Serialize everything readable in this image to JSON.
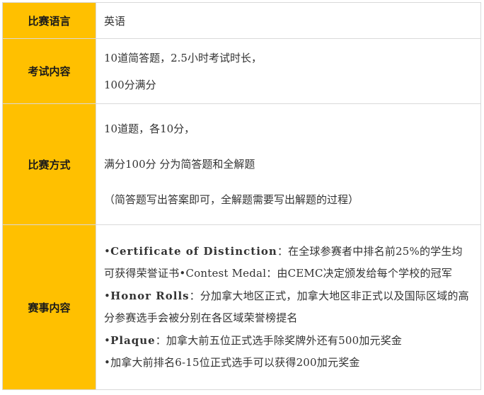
{
  "rows": [
    {
      "label": "比赛语言",
      "lines": [
        "英语"
      ]
    },
    {
      "label": "考试内容",
      "lines": [
        "10道简答题，2.5小时考试时长，",
        "100分满分"
      ]
    },
    {
      "label": "比赛方式",
      "lines": [
        "10道题，各10分，",
        "满分100分 分为简答题和全解题",
        "（简答题写出答案即可，全解题需要写出解题的过程）"
      ]
    },
    {
      "label": "赛事内容",
      "items": [
        {
          "bullet": "•",
          "title": "Certificate of Distinction",
          "text": "：在全球参赛者中排名前25%的学生均可获得荣誉证书•Contest Medal：由CEMC决定颁发给每个学校的冠军"
        },
        {
          "bullet": "•",
          "title": "Honor Rolls",
          "text": "：分加拿大地区正式，加拿大地区非正式以及国际区域的高分参赛选手会被分别在各区域荣誉榜提名"
        },
        {
          "bullet": "•",
          "title": "Plaque",
          "text": "：加拿大前五位正式选手除奖牌外还有500加元奖金"
        },
        {
          "bullet": "•",
          "title": "",
          "text": "加拿大前排名6-15位正式选手可以获得200加元奖金"
        }
      ]
    }
  ]
}
